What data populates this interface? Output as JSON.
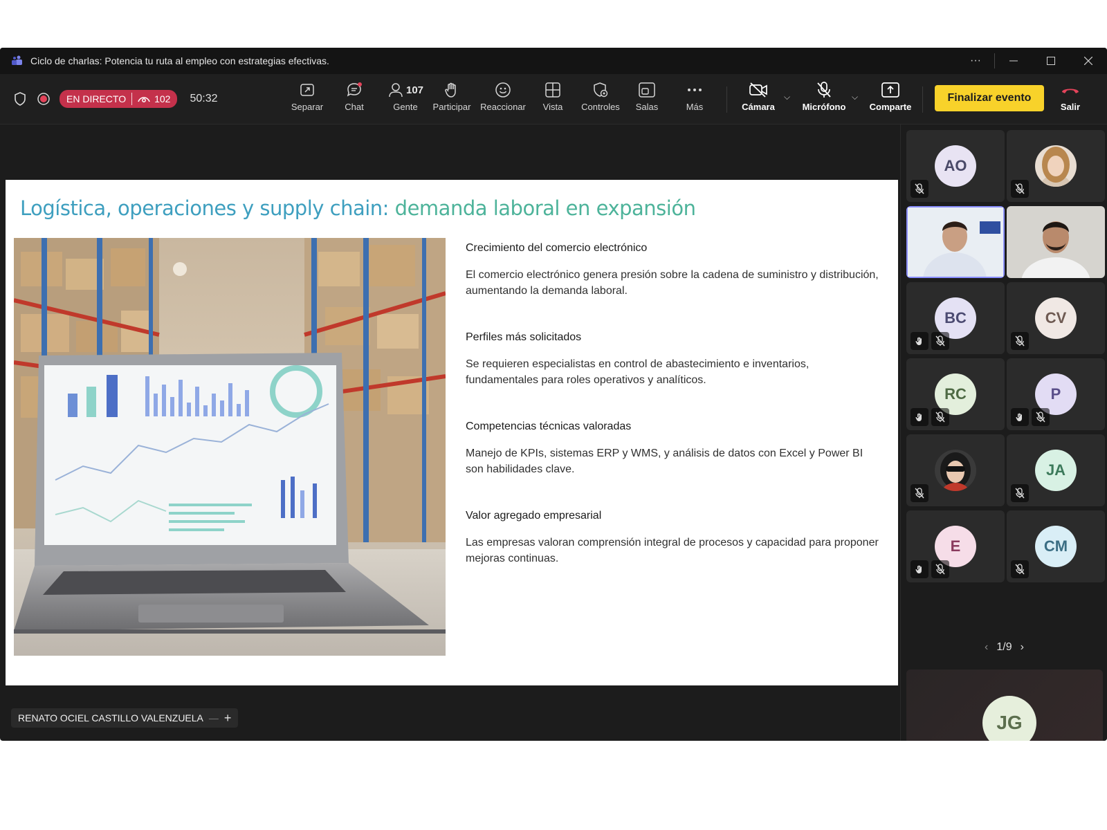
{
  "window": {
    "title": "Ciclo de charlas: Potencia tu ruta al empleo con estrategias efectivas.",
    "more_label": "···"
  },
  "toolbar": {
    "live_label": "EN DIRECTO",
    "viewers": "102",
    "timer": "50:32",
    "people_count": "107",
    "items": {
      "separar": "Separar",
      "chat": "Chat",
      "gente": "Gente",
      "participar": "Participar",
      "reaccionar": "Reaccionar",
      "vista": "Vista",
      "controles": "Controles",
      "salas": "Salas",
      "mas": "Más",
      "camara": "Cámara",
      "microfono": "Micrófono",
      "comparte": "Comparte",
      "salir": "Salir"
    },
    "end_event": "Finalizar evento",
    "colors": {
      "live": "#c4314b",
      "end_button": "#f8d22a",
      "hangup": "#e3435a"
    }
  },
  "slide": {
    "title_part1": "Logística, operaciones y supply chain: ",
    "title_part2": "demanda laboral en expansión",
    "points": [
      {
        "heading": "Crecimiento del comercio electrónico",
        "text": "El comercio electrónico genera presión sobre la cadena de suministro y distribución, aumentando la demanda laboral."
      },
      {
        "heading": "Perfiles más solicitados",
        "text": "Se requieren especialistas en control de abastecimiento e inventarios, fundamentales para roles operativos y analíticos."
      },
      {
        "heading": "Competencias técnicas valoradas",
        "text": "Manejo de KPIs, sistemas ERP y WMS, y análisis de datos con Excel y Power BI son habilidades clave."
      },
      {
        "heading": "Valor agregado empresarial",
        "text": "Las empresas valoran comprensión integral de procesos y capacidad para proponer mejoras continuas."
      }
    ]
  },
  "presenter": {
    "name": "RENATO OCIEL CASTILLO VALENZUELA"
  },
  "participants": [
    {
      "initials": "AO",
      "bg": "#e8e3f3",
      "fg": "#4a4a68"
    },
    {
      "initials": "",
      "photo": "woman"
    },
    {
      "initials": "",
      "photo": "man1",
      "active": true
    },
    {
      "initials": "",
      "photo": "man2"
    },
    {
      "initials": "BC",
      "bg": "#e4e1f4",
      "fg": "#4c4b72"
    },
    {
      "initials": "CV",
      "bg": "#f0e8e4",
      "fg": "#6e5a52"
    },
    {
      "initials": "RC",
      "bg": "#e3efdc",
      "fg": "#4f6b45"
    },
    {
      "initials": "P",
      "bg": "#e2dcf4",
      "fg": "#5a4f8a"
    },
    {
      "initials": "",
      "photo": "woman2"
    },
    {
      "initials": "JA",
      "bg": "#d8f1e4",
      "fg": "#3c7a5b"
    },
    {
      "initials": "E",
      "bg": "#f6dde8",
      "fg": "#8a3b5e"
    },
    {
      "initials": "CM",
      "bg": "#d9eef6",
      "fg": "#3b6e84"
    }
  ],
  "pager": {
    "label": "1/9"
  },
  "spotlight": {
    "initials": "JG",
    "bg": "#e6efdc",
    "fg": "#5c6f4e"
  }
}
